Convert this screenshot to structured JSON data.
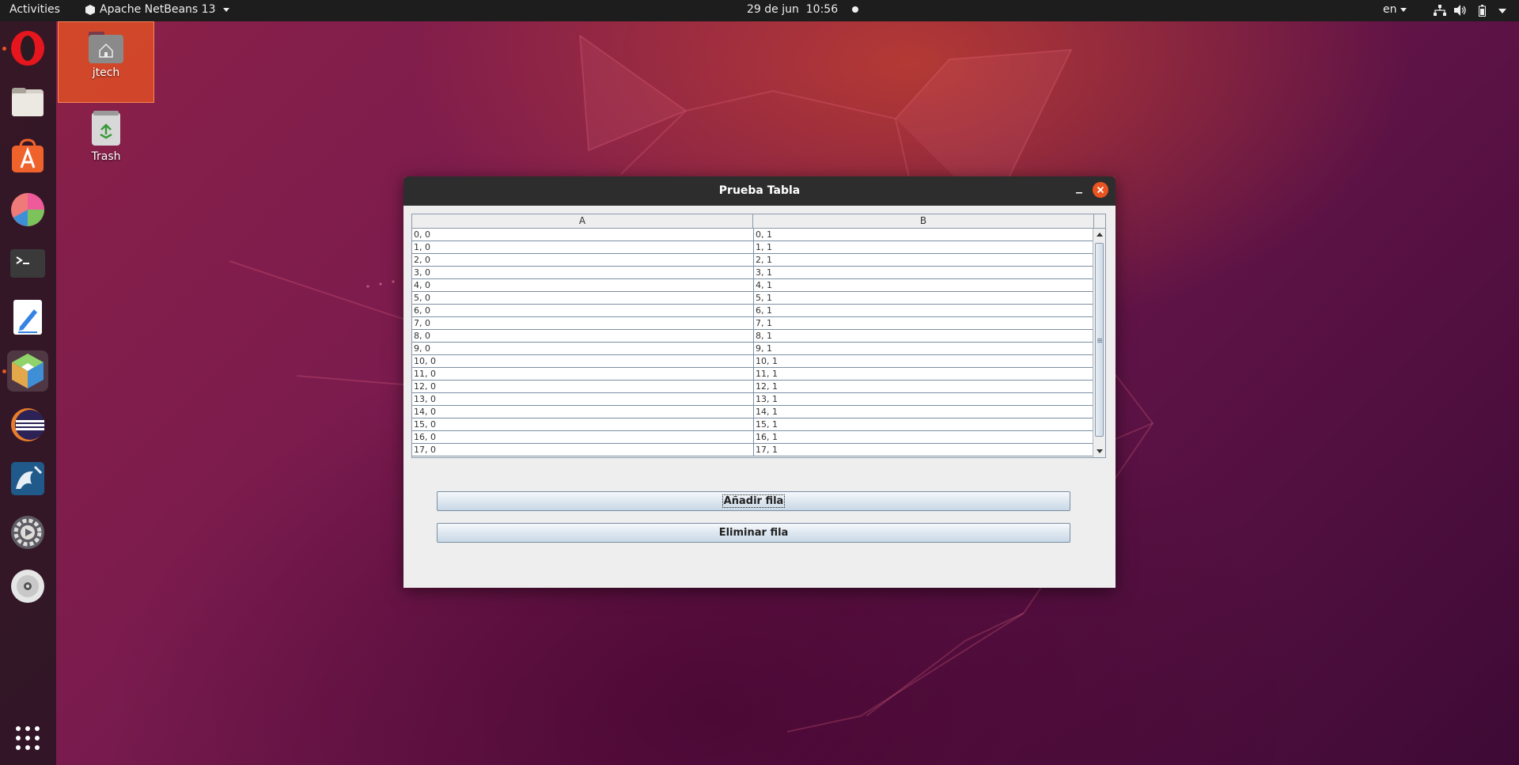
{
  "topbar": {
    "activities": "Activities",
    "app_name": "Apache NetBeans 13",
    "datetime": "29 de jun  10:56",
    "lang": "en"
  },
  "dock": {
    "items": [
      {
        "name": "opera-icon",
        "running": true
      },
      {
        "name": "files-icon"
      },
      {
        "name": "software-store-icon"
      },
      {
        "name": "chart-app-icon"
      },
      {
        "name": "terminal-icon"
      },
      {
        "name": "text-editor-icon"
      },
      {
        "name": "netbeans-icon",
        "running": true,
        "active": true
      },
      {
        "name": "eclipse-icon"
      },
      {
        "name": "mysql-workbench-icon"
      },
      {
        "name": "settings-icon"
      },
      {
        "name": "dvd-icon"
      },
      {
        "name": "show-apps-icon"
      }
    ]
  },
  "desktop": {
    "home_label": "jtech",
    "trash_label": "Trash"
  },
  "window": {
    "title": "Prueba Tabla",
    "table": {
      "columns": [
        "A",
        "B"
      ],
      "rows": [
        [
          "0, 0",
          "0, 1"
        ],
        [
          "1, 0",
          "1, 1"
        ],
        [
          "2, 0",
          "2, 1"
        ],
        [
          "3, 0",
          "3, 1"
        ],
        [
          "4, 0",
          "4, 1"
        ],
        [
          "5, 0",
          "5, 1"
        ],
        [
          "6, 0",
          "6, 1"
        ],
        [
          "7, 0",
          "7, 1"
        ],
        [
          "8, 0",
          "8, 1"
        ],
        [
          "9, 0",
          "9, 1"
        ],
        [
          "10, 0",
          "10, 1"
        ],
        [
          "11, 0",
          "11, 1"
        ],
        [
          "12, 0",
          "12, 1"
        ],
        [
          "13, 0",
          "13, 1"
        ],
        [
          "14, 0",
          "14, 1"
        ],
        [
          "15, 0",
          "15, 1"
        ],
        [
          "16, 0",
          "16, 1"
        ],
        [
          "17, 0",
          "17, 1"
        ]
      ]
    },
    "buttons": {
      "add": "Añadir fila",
      "remove": "Eliminar fila"
    }
  },
  "colors": {
    "accent": "#e95420",
    "panel": "#1d1d1d"
  }
}
